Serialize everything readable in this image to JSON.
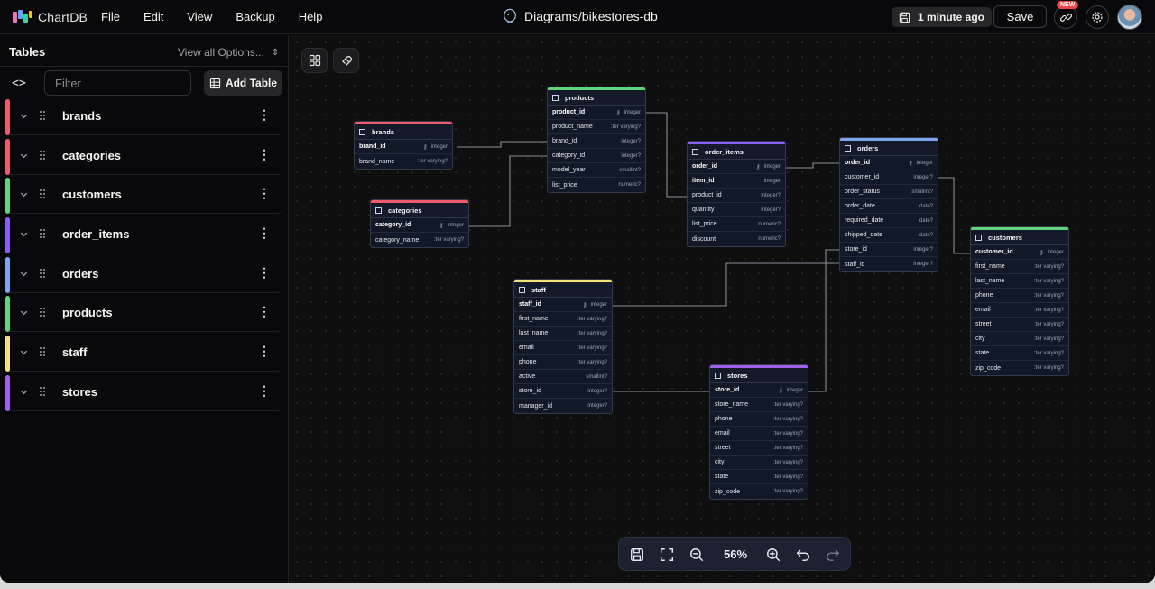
{
  "app": {
    "name": "ChartDB"
  },
  "menu": [
    "File",
    "Edit",
    "View",
    "Backup",
    "Help"
  ],
  "diagram": {
    "title": "Diagrams/bikestores-db"
  },
  "header": {
    "saved_status": "1 minute ago",
    "save_label": "Save",
    "new_badge": "NEW"
  },
  "sidebar": {
    "title": "Tables",
    "view_options": "View all Options...",
    "filter_placeholder": "Filter",
    "add_table_label": "Add Table",
    "code_toggle": "<>",
    "tables": [
      {
        "name": "brands",
        "color": "#ef5b6b"
      },
      {
        "name": "categories",
        "color": "#ef5b6b"
      },
      {
        "name": "customers",
        "color": "#5fd47a"
      },
      {
        "name": "order_items",
        "color": "#8b5cf6"
      },
      {
        "name": "orders",
        "color": "#7ea6f0"
      },
      {
        "name": "products",
        "color": "#5fd47a"
      },
      {
        "name": "staff",
        "color": "#f3e27a"
      },
      {
        "name": "stores",
        "color": "#a061e8"
      }
    ]
  },
  "canvas": {
    "zoom_level": "56%",
    "tables": {
      "brands": {
        "name": "brands",
        "color": "#ef5b6b",
        "fields": [
          {
            "name": "brand_id",
            "type": "integer",
            "pk": true
          },
          {
            "name": "brand_name",
            "type": ":ter varying?"
          }
        ]
      },
      "categories": {
        "name": "categories",
        "color": "#ef5b6b",
        "fields": [
          {
            "name": "category_id",
            "type": "integer",
            "pk": true
          },
          {
            "name": "category_name",
            "type": ":ter varying?"
          }
        ]
      },
      "products": {
        "name": "products",
        "color": "#5fd47a",
        "fields": [
          {
            "name": "product_id",
            "type": "integer",
            "pk": true
          },
          {
            "name": "product_name",
            "type": ":ter varying?"
          },
          {
            "name": "brand_id",
            "type": "integer?"
          },
          {
            "name": "category_id",
            "type": "integer?"
          },
          {
            "name": "model_year",
            "type": "smallint?"
          },
          {
            "name": "list_price",
            "type": "numeric?"
          }
        ]
      },
      "order_items": {
        "name": "order_items",
        "color": "#8b5cf6",
        "fields": [
          {
            "name": "order_id",
            "type": "integer",
            "pk": true
          },
          {
            "name": "item_id",
            "type": "integer",
            "pk": true,
            "nokey": true
          },
          {
            "name": "product_id",
            "type": "integer?"
          },
          {
            "name": "quantity",
            "type": "integer?"
          },
          {
            "name": "list_price",
            "type": "numeric?"
          },
          {
            "name": "discount",
            "type": "numeric?"
          }
        ]
      },
      "orders": {
        "name": "orders",
        "color": "#7ea6f0",
        "fields": [
          {
            "name": "order_id",
            "type": "integer",
            "pk": true
          },
          {
            "name": "customer_id",
            "type": "integer?"
          },
          {
            "name": "order_status",
            "type": "smallint?"
          },
          {
            "name": "order_date",
            "type": "date?"
          },
          {
            "name": "required_date",
            "type": "date?"
          },
          {
            "name": "shipped_date",
            "type": "date?"
          },
          {
            "name": "store_id",
            "type": "integer?"
          },
          {
            "name": "staff_id",
            "type": "integer?"
          }
        ]
      },
      "customers": {
        "name": "customers",
        "color": "#5fd47a",
        "fields": [
          {
            "name": "customer_id",
            "type": "integer",
            "pk": true
          },
          {
            "name": "first_name",
            "type": ":ter varying?"
          },
          {
            "name": "last_name",
            "type": ":ter varying?"
          },
          {
            "name": "phone",
            "type": ":ter varying?"
          },
          {
            "name": "email",
            "type": ":ter varying?"
          },
          {
            "name": "street",
            "type": ":ter varying?"
          },
          {
            "name": "city",
            "type": ":ter varying?"
          },
          {
            "name": "state",
            "type": ":ter varying?"
          },
          {
            "name": "zip_code",
            "type": ":ter varying?"
          }
        ]
      },
      "staff": {
        "name": "staff",
        "color": "#f3e27a",
        "fields": [
          {
            "name": "staff_id",
            "type": "integer",
            "pk": true
          },
          {
            "name": "first_name",
            "type": ":ter varying?"
          },
          {
            "name": "last_name",
            "type": ":ter varying?"
          },
          {
            "name": "email",
            "type": ":ter varying?"
          },
          {
            "name": "phone",
            "type": ":ter varying?"
          },
          {
            "name": "active",
            "type": "smallint?"
          },
          {
            "name": "store_id",
            "type": "integer?"
          },
          {
            "name": "manager_id",
            "type": "integer?"
          }
        ]
      },
      "stores": {
        "name": "stores",
        "color": "#a061e8",
        "fields": [
          {
            "name": "store_id",
            "type": "integer",
            "pk": true
          },
          {
            "name": "store_name",
            "type": ":ter varying?"
          },
          {
            "name": "phone",
            "type": ":ter varying?"
          },
          {
            "name": "email",
            "type": ":ter varying?"
          },
          {
            "name": "street",
            "type": ":ter varying?"
          },
          {
            "name": "city",
            "type": ":ter varying?"
          },
          {
            "name": "state",
            "type": ":ter varying?"
          },
          {
            "name": "zip_code",
            "type": ":ter varying?"
          }
        ]
      }
    }
  }
}
